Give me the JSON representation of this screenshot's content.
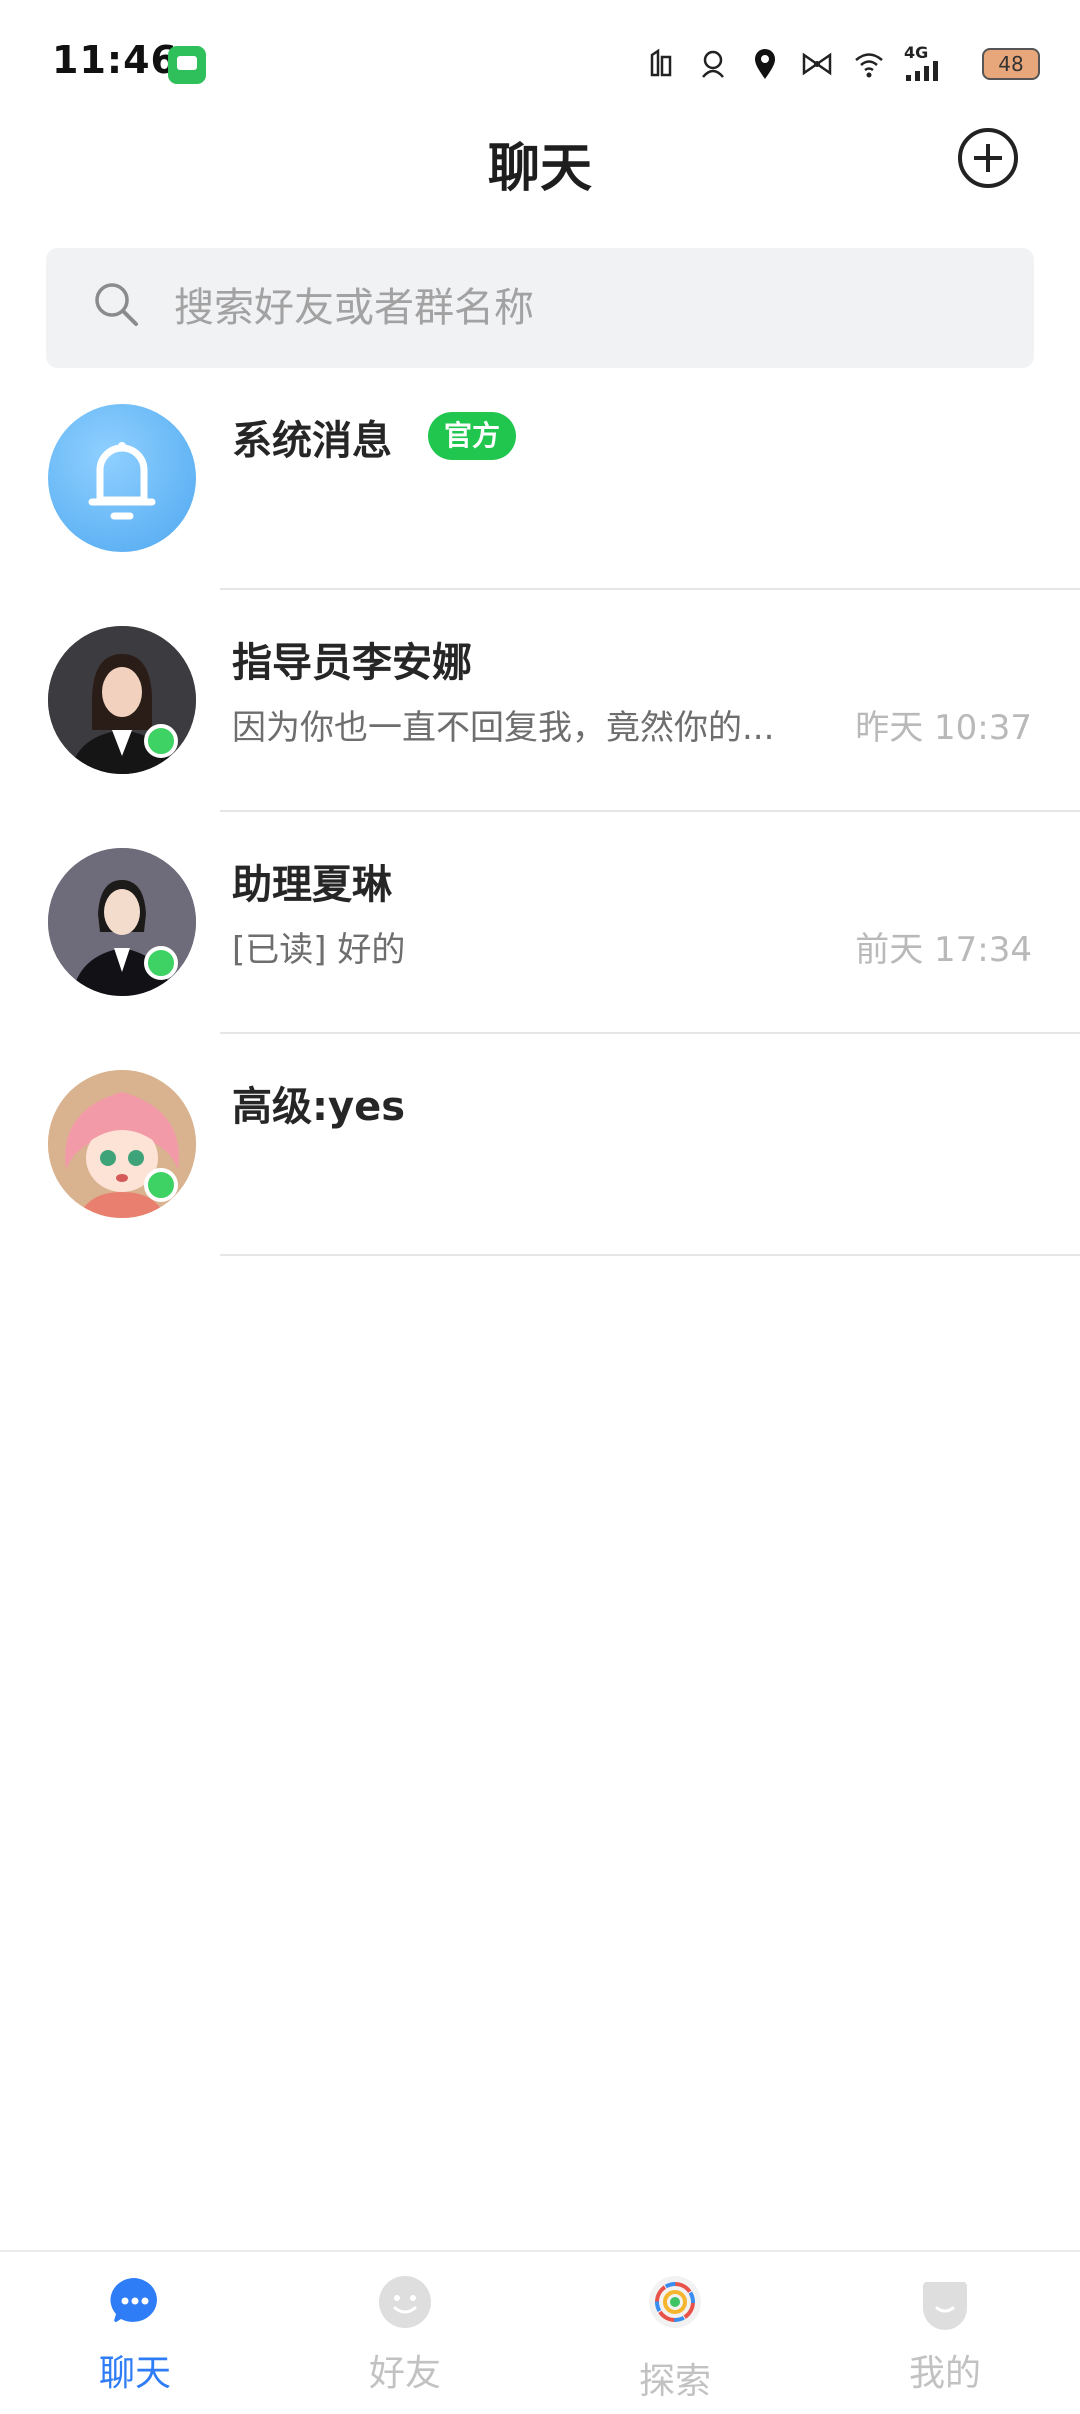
{
  "status_bar": {
    "time": "11:46",
    "network": "4G",
    "battery": "48"
  },
  "header": {
    "title": "聊天"
  },
  "search": {
    "placeholder": "搜索好友或者群名称"
  },
  "conversations": [
    {
      "name": "系统消息",
      "badge": "官方",
      "preview": "",
      "time": "",
      "online": false,
      "avatar": "bell-icon"
    },
    {
      "name": "指导员李安娜",
      "badge": "",
      "preview": "因为你也一直不回复我，竟然你的...",
      "time": "昨天 10:37",
      "online": true,
      "avatar": "person"
    },
    {
      "name": "助理夏琳",
      "badge": "",
      "preview": "[已读] 好的",
      "time": "前天 17:34",
      "online": true,
      "avatar": "person"
    },
    {
      "name": "高级:yes",
      "badge": "",
      "preview": "",
      "time": "",
      "online": true,
      "avatar": "anime"
    }
  ],
  "tabs": [
    {
      "label": "聊天",
      "icon": "chat-bubble-icon",
      "active": true
    },
    {
      "label": "好友",
      "icon": "smiley-icon",
      "active": false
    },
    {
      "label": "探索",
      "icon": "aperture-icon",
      "active": false
    },
    {
      "label": "我的",
      "icon": "profile-icon",
      "active": false
    }
  ],
  "colors": {
    "accent": "#2e7cf6",
    "online": "#3ed264",
    "badge": "#21c64f"
  }
}
